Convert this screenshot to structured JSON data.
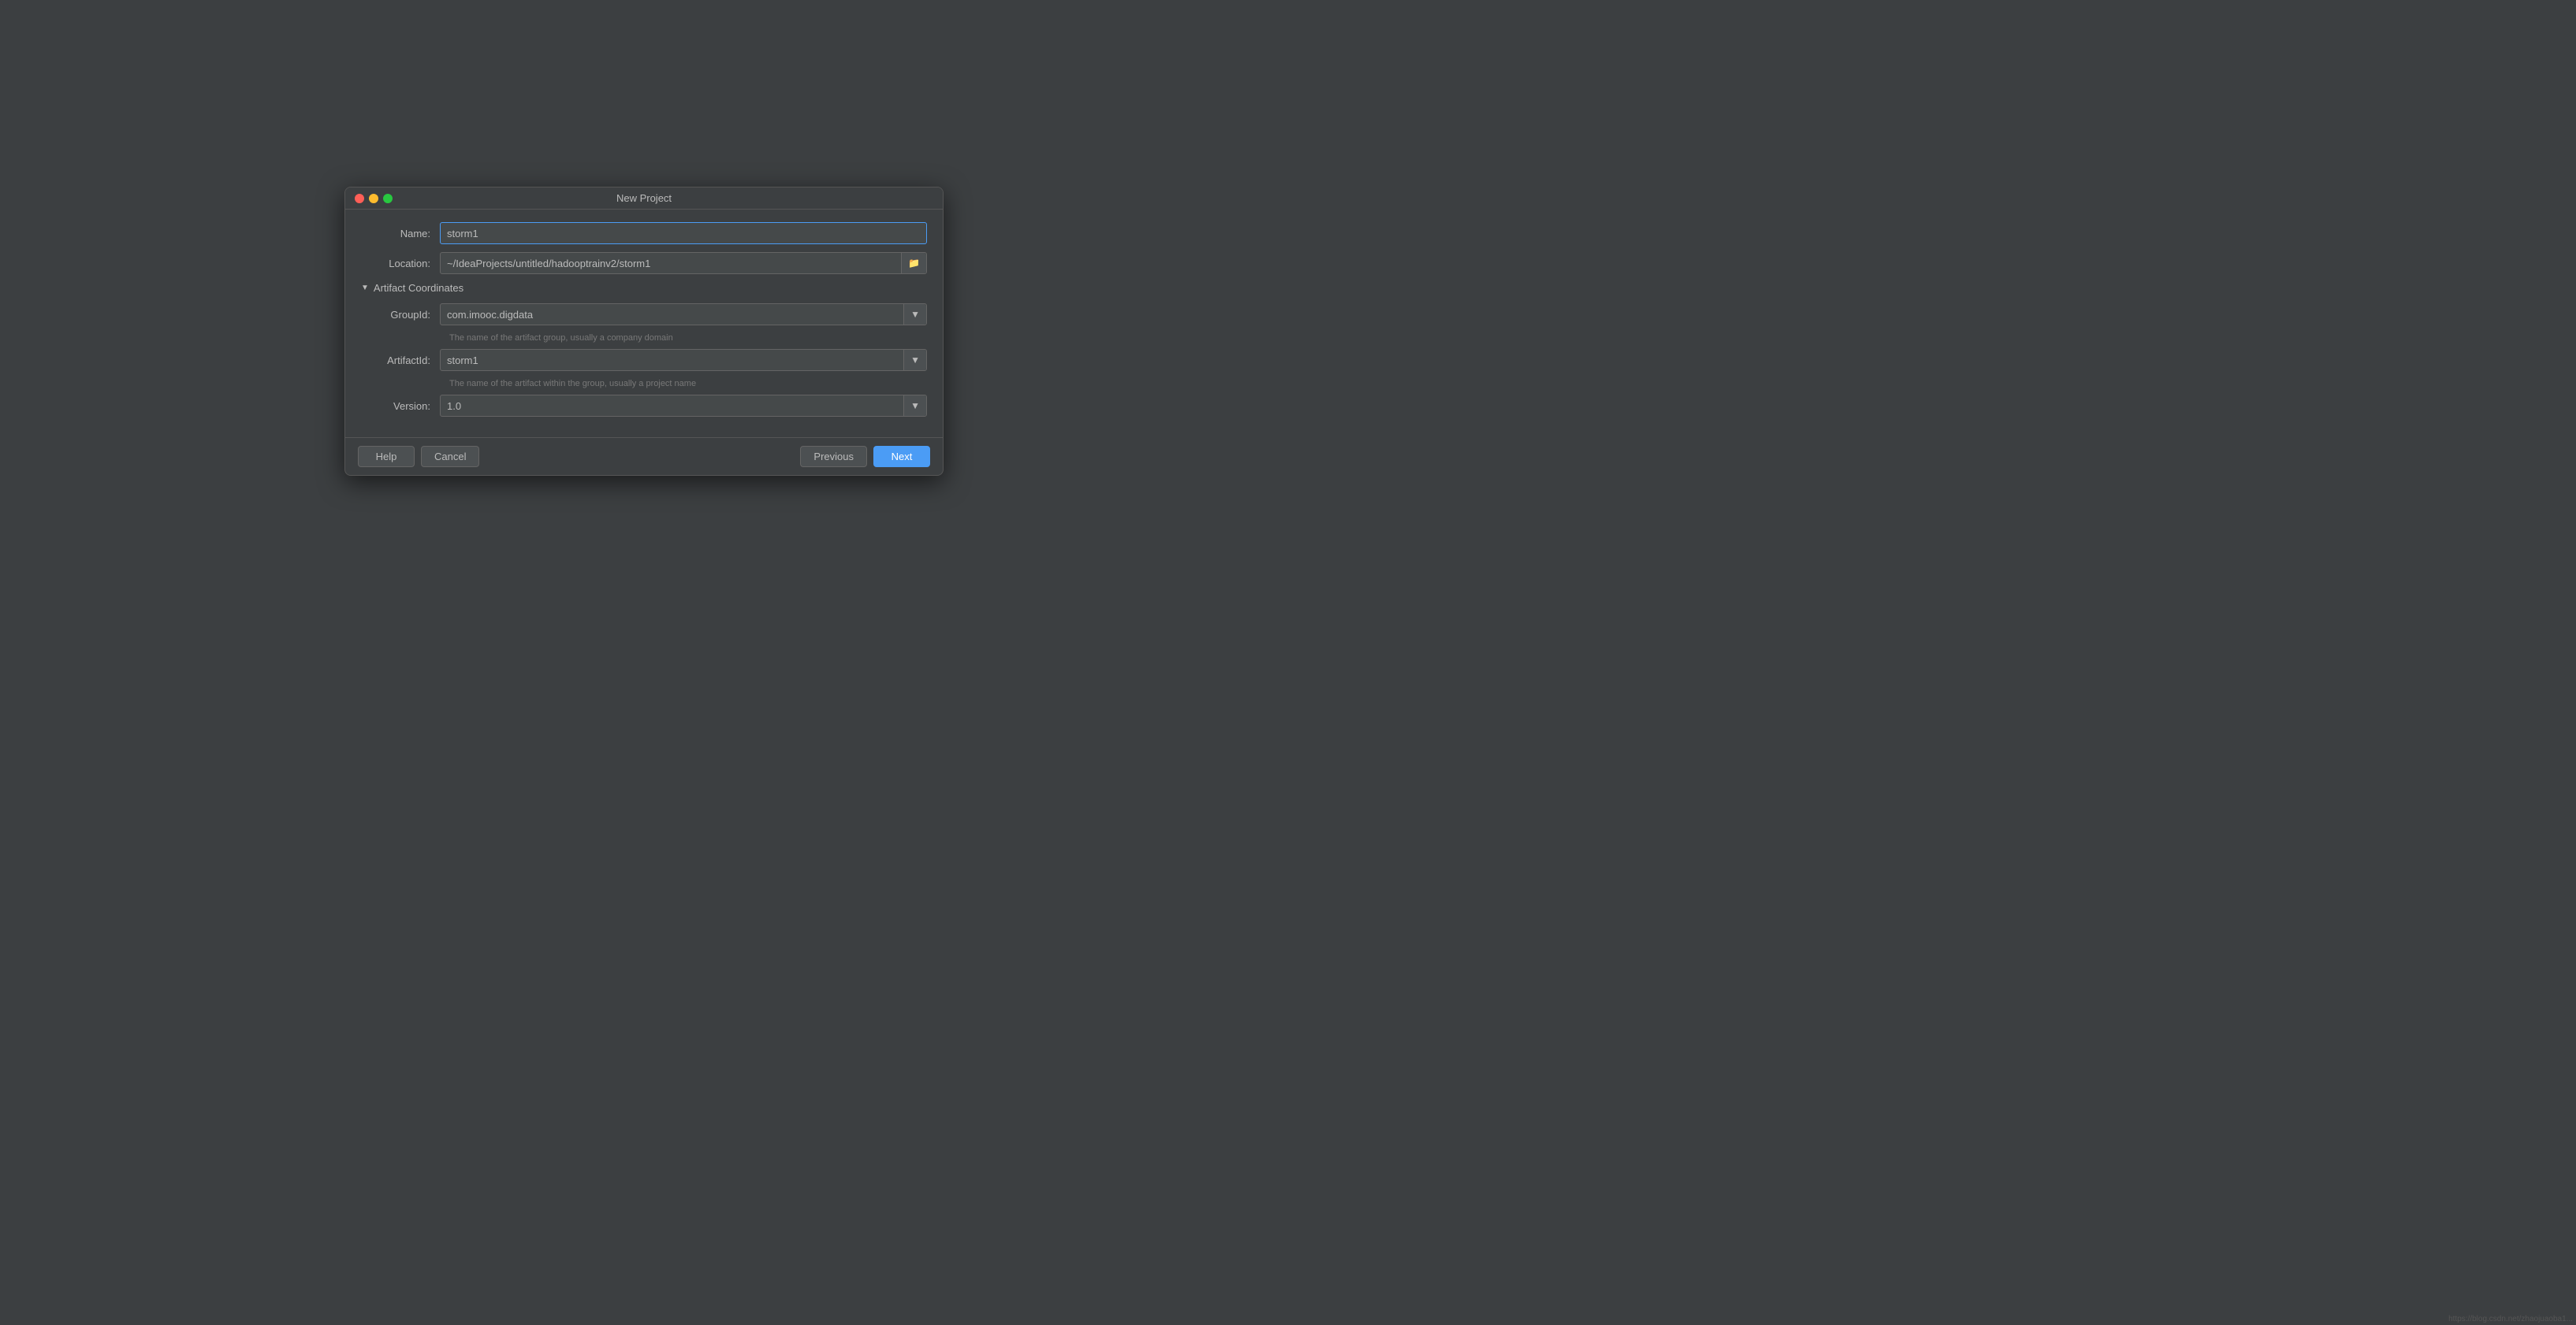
{
  "window": {
    "title": "New Project"
  },
  "form": {
    "name_label": "Name:",
    "name_value": "storm1",
    "location_label": "Location:",
    "location_value": "~/IdeaProjects/untitled/hadooptrainv2/storm1",
    "artifact_section_title": "Artifact Coordinates",
    "groupid_label": "GroupId:",
    "groupid_value": "com.imooc.digdata",
    "groupid_hint": "The name of the artifact group, usually a company domain",
    "artifactid_label": "ArtifactId:",
    "artifactid_value": "storm1",
    "artifactid_hint": "The name of the artifact within the group, usually a project name",
    "version_label": "Version:",
    "version_value": "1.0"
  },
  "footer": {
    "help_label": "Help",
    "cancel_label": "Cancel",
    "previous_label": "Previous",
    "next_label": "Next"
  },
  "watermark": "https://blog.csdn.net/zhaojuaoba1..."
}
